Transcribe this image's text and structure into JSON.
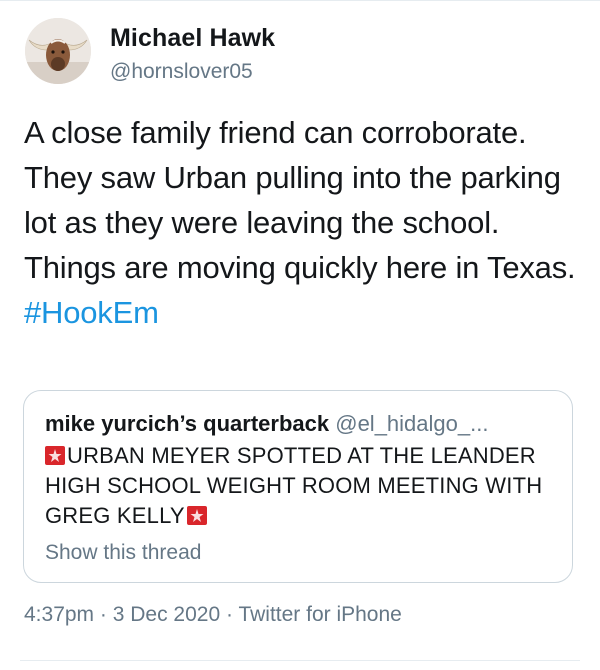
{
  "author": {
    "name": "Michael Hawk",
    "handle": "@hornslover05"
  },
  "tweet": {
    "text": "A close family friend can corroborate. They saw Urban pulling into the parking lot as they were leaving the school. Things are moving quickly here in Texas.",
    "hashtag": "#HookEm"
  },
  "quoted_tweet": {
    "name": "mike yurcich’s quarterback",
    "handle": "@el_hidalgo_...",
    "text": "URBAN MEYER SPOTTED AT THE LEANDER HIGH SCHOOL WEIGHT ROOM MEETING WITH GREG KELLY",
    "leading_icon": "police-light-emoji",
    "trailing_icon": "police-light-emoji",
    "show_thread": "Show this thread"
  },
  "meta": {
    "time": "4:37pm",
    "separator": " · ",
    "date": "3 Dec 2020",
    "source": "Twitter for iPhone"
  },
  "colors": {
    "link": "#1b95e0",
    "secondary_text": "#657786",
    "border": "#ccd6dd",
    "emoji": "#d9262b"
  }
}
